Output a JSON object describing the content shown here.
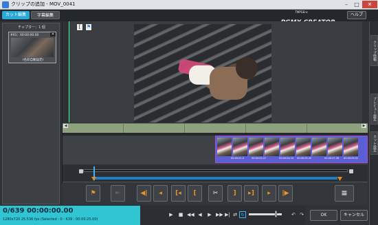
{
  "window": {
    "title": "クリップの追加 - MOV_0041",
    "minimize_glyph": "–",
    "maximize_glyph": "□",
    "close_glyph": "✕"
  },
  "topbar": {
    "tabs": [
      {
        "label": "カット編集",
        "active": true
      },
      {
        "label": "字幕編集",
        "active": false
      }
    ],
    "brand_small": "TMPGEnc",
    "brand_big": "PGMX CREATOR",
    "help_label": "ヘルプ"
  },
  "chapters": {
    "label": "チャプター：1 個",
    "items": [
      {
        "title": "#01：00:00:00.00",
        "name": "(名前自動設定)",
        "close": "✕"
      }
    ]
  },
  "preview": {
    "marker_buttons": [
      {
        "icon": "bracket-marker-icon",
        "glyph": "["
      },
      {
        "icon": "flag-marker-icon",
        "glyph": "⚑"
      }
    ]
  },
  "side_tabs": [
    "クリップ情報",
    "プレビュー設定",
    "カット設定"
  ],
  "timeline": {
    "scroll_left": "◀",
    "scroll_right": "▶",
    "clip_timecodes": [
      "00:00:01.0",
      "00:00:02.07",
      "00:00:04.15",
      "00:00:05.20",
      "00:00:07.28",
      "00:00:09.01"
    ]
  },
  "edit_toolbar": {
    "buttons": [
      {
        "name": "set-chapter-button",
        "glyph": "⚑",
        "enabled": true
      },
      {
        "name": "delete-chapter-button",
        "glyph": "⇤",
        "enabled": false
      },
      {
        "name": "go-to-start-button",
        "glyph": "◀|",
        "enabled": true
      },
      {
        "name": "prev-frame-button",
        "glyph": "◂",
        "enabled": true
      },
      {
        "name": "go-to-cut-start-button",
        "glyph": "[◂",
        "enabled": true
      },
      {
        "name": "set-cut-start-button",
        "glyph": "[",
        "enabled": true
      },
      {
        "name": "cut-button",
        "glyph": "✂",
        "enabled": true
      },
      {
        "name": "set-cut-end-button",
        "glyph": "]",
        "enabled": true
      },
      {
        "name": "go-to-cut-end-button",
        "glyph": "▸]",
        "enabled": true
      },
      {
        "name": "next-frame-button",
        "glyph": "▸",
        "enabled": true
      },
      {
        "name": "go-to-end-button",
        "glyph": "|▶",
        "enabled": true
      },
      {
        "name": "cut-list-button",
        "glyph": "≡",
        "enabled": true
      }
    ]
  },
  "status": {
    "main": "0/639  00:00:00.00",
    "sub": "1280x720 25.536 fps  (Selected : 0 - 639 : 00:00:25.00)"
  },
  "player": {
    "buttons": [
      {
        "name": "play-button",
        "glyph": "▶"
      },
      {
        "name": "stop-button",
        "glyph": "■"
      },
      {
        "name": "rewind-button",
        "glyph": "◀◀"
      },
      {
        "name": "step-back-button",
        "glyph": "◀"
      },
      {
        "name": "step-forward-button",
        "glyph": "▶"
      },
      {
        "name": "fast-forward-button",
        "glyph": "▶▶"
      },
      {
        "name": "go-end-button",
        "glyph": "▶|"
      },
      {
        "name": "loop-button",
        "glyph": "⇄"
      },
      {
        "name": "repeat-button",
        "glyph": "↻"
      }
    ],
    "undo_glyph": "↶",
    "redo_glyph": "↷",
    "volume": 0.8
  },
  "dialog": {
    "ok_label": "OK",
    "cancel_label": "キャンセル"
  },
  "colors": {
    "accent": "#2aa9d6",
    "status_bg": "#31c4d2",
    "cut_marker": "#e08a24",
    "timeline_green": "#8fa27f",
    "clip_strip": "#5a5fd6"
  }
}
